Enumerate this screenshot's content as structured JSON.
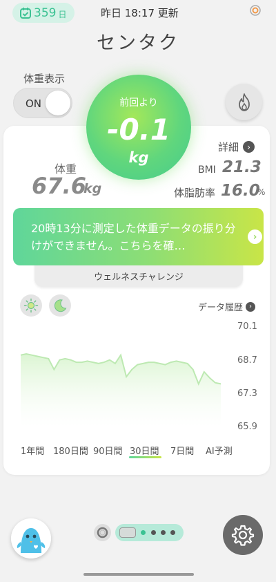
{
  "status": {
    "streak_count": "359",
    "streak_unit": "日",
    "updated": "昨日 18:17 更新"
  },
  "header": {
    "title": "センタク"
  },
  "toggle": {
    "label": "体重表示",
    "state": "ON"
  },
  "delta": {
    "label": "前回より",
    "value": "-0.1",
    "unit": "kg"
  },
  "metrics": {
    "detail_label": "詳細",
    "weight_label": "体重",
    "weight_value": "67.6",
    "weight_unit": "kg",
    "bmi_label": "BMI",
    "bmi_value": "21.3",
    "fat_label": "体脂肪率",
    "fat_value": "16.0",
    "fat_unit": "%"
  },
  "banner": {
    "text": "20時13分に測定した体重データの振り分けができません。こちらを確…"
  },
  "challenge": {
    "label": "ウェルネスチャレンジ"
  },
  "history": {
    "label": "データ履歴"
  },
  "chart_data": {
    "type": "area",
    "ylim": [
      65.9,
      70.1
    ],
    "yticks": [
      "70.1",
      "68.7",
      "67.3",
      "65.9"
    ],
    "values": [
      68.9,
      68.95,
      68.9,
      68.85,
      68.8,
      68.75,
      68.3,
      68.7,
      68.75,
      68.7,
      68.6,
      68.6,
      68.65,
      68.6,
      68.55,
      68.6,
      68.7,
      68.55,
      68.9,
      68.0,
      68.3,
      68.5,
      68.55,
      68.6,
      68.6,
      68.55,
      68.5,
      68.6,
      68.65,
      68.6,
      68.55,
      68.3,
      67.7,
      68.2,
      67.95,
      67.75,
      67.7
    ],
    "colors": {
      "line": "#bde9b2",
      "fill_top": "#dbf5d2",
      "fill_bottom": "#ffffff"
    }
  },
  "periods": [
    {
      "label": "1年間",
      "selected": false
    },
    {
      "label": "180日間",
      "selected": false
    },
    {
      "label": "90日間",
      "selected": false
    },
    {
      "label": "30日間",
      "selected": true
    },
    {
      "label": "7日間",
      "selected": false
    },
    {
      "label": "AI予測",
      "selected": false
    }
  ],
  "icons": {
    "streak": "calendar-check-icon",
    "corner": "target-icon",
    "flame": "flame-icon",
    "sun": "sun-icon",
    "moon": "moon-icon",
    "gear": "gear-icon",
    "ring": "ring-icon"
  },
  "colors": {
    "accent": "#3cc293",
    "gradient_start": "#5fd69a",
    "gradient_end": "#c9e547"
  }
}
